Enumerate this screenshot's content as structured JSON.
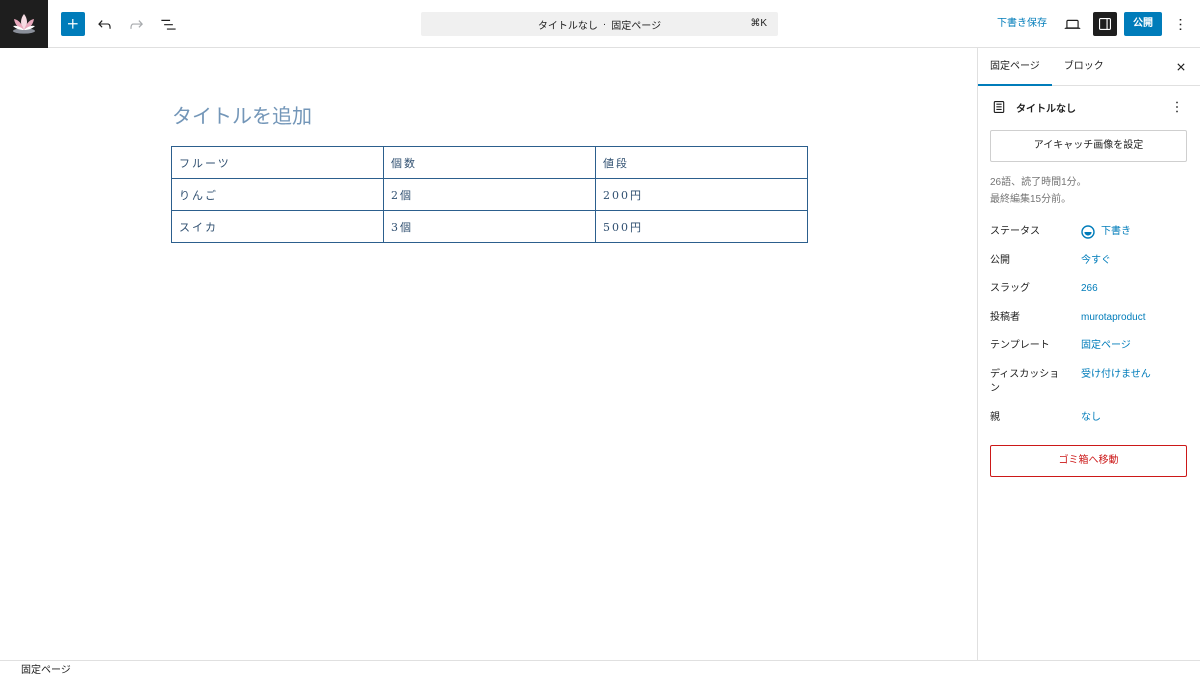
{
  "icons": {
    "site": "site-lotus-icon",
    "add_block": "plus-icon",
    "undo": "undo-icon",
    "redo": "redo-icon",
    "list_view": "list-view-icon",
    "preview": "desktop-icon",
    "settings": "sidebar-panel-icon",
    "options": "more-vertical-icon",
    "close": "close-icon",
    "page": "page-icon",
    "status": "draft-status-icon"
  },
  "colors": {
    "accent": "#007cba",
    "danger": "#cc1818",
    "text": "#1e1e1e",
    "muted": "#757575",
    "border": "#e0e0e0",
    "title_placeholder": "#7396b8",
    "table_border": "#2c5f8d",
    "table_text": "#2f4f70"
  },
  "header": {
    "command_bar": {
      "title": "タイトルなし",
      "separator": "·",
      "post_type": "固定ページ",
      "shortcut": "⌘K"
    },
    "save_draft_label": "下書き保存",
    "publish_label": "公開"
  },
  "editor": {
    "title_placeholder": "タイトルを追加",
    "table": {
      "rows": [
        [
          "フルーツ",
          "個数",
          "値段"
        ],
        [
          "りんご",
          "2個",
          "200円"
        ],
        [
          "スイカ",
          "3個",
          "500円"
        ]
      ]
    }
  },
  "sidebar": {
    "tabs": [
      {
        "label": "固定ページ",
        "active": true
      },
      {
        "label": "ブロック",
        "active": false
      }
    ],
    "document": {
      "title": "タイトルなし"
    },
    "featured_image_button": "アイキャッチ画像を設定",
    "stats": {
      "word_count": "26語、読了時間1分。",
      "last_edited": "最終編集15分前。"
    },
    "meta": [
      {
        "label": "ステータス",
        "value": "下書き"
      },
      {
        "label": "公開",
        "value": "今すぐ"
      },
      {
        "label": "スラッグ",
        "value": "266"
      },
      {
        "label": "投稿者",
        "value": "murotaproduct"
      },
      {
        "label": "テンプレート",
        "value": "固定ページ"
      },
      {
        "label": "ディスカッション",
        "value": "受け付けません"
      },
      {
        "label": "親",
        "value": "なし"
      }
    ],
    "trash_button": "ゴミ箱へ移動"
  },
  "footer": {
    "breadcrumb": "固定ページ"
  }
}
